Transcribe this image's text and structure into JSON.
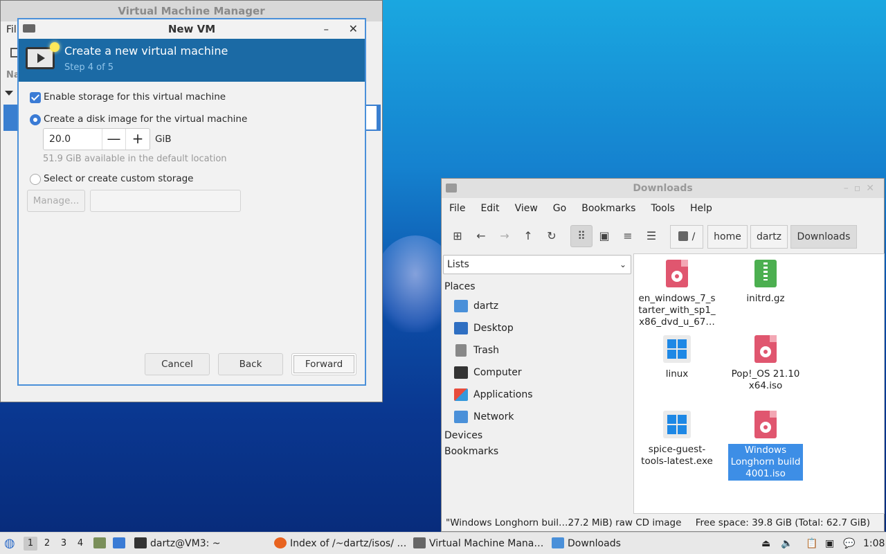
{
  "vmm_window": {
    "title": "Virtual Machine Manager",
    "menu_partial": "Fil",
    "column_partial": "Na"
  },
  "dialog": {
    "title": "New VM",
    "minimize": "–",
    "close": "✕",
    "banner_title": "Create a new virtual machine",
    "banner_step": "Step 4 of 5",
    "enable_storage": "Enable storage for this virtual machine",
    "create_disk": "Create a disk image for the virtual machine",
    "disk_size": "20.0",
    "minus": "—",
    "plus": "+",
    "unit": "GiB",
    "available": "51.9 GiB available in the default location",
    "custom_storage": "Select or create custom storage",
    "manage_label": "Manage...",
    "cancel_label": "Cancel",
    "back_label": "Back",
    "forward_label": "Forward"
  },
  "file_manager": {
    "title": "Downloads",
    "menu": [
      "File",
      "Edit",
      "View",
      "Go",
      "Bookmarks",
      "Tools",
      "Help"
    ],
    "breadcrumbs": [
      "/",
      "home",
      "dartz",
      "Downloads"
    ],
    "side_pane_mode": "Lists",
    "places_header": "Places",
    "places": [
      "dartz",
      "Desktop",
      "Trash",
      "Computer",
      "Applications",
      "Network"
    ],
    "devices_header": "Devices",
    "bookmarks_header": "Bookmarks",
    "files": [
      {
        "name_line1": "en_windows_7_s",
        "name_line2": "tarter_with_sp1_",
        "name_line3": "x86_dvd_u_67…",
        "icon": "disc-image-icon"
      },
      {
        "name_line1": "initrd.gz",
        "icon": "archive-icon"
      },
      {
        "name_line1": "linux",
        "icon": "windows-executable-icon"
      },
      {
        "name_line1": "Pop!_OS 21.10",
        "name_line2": "x64.iso",
        "icon": "disc-image-icon"
      },
      {
        "name_line1": "spice-guest-",
        "name_line2": "tools-latest.exe",
        "icon": "windows-executable-icon"
      },
      {
        "name_line1": "Windows",
        "name_line2": "Longhorn build",
        "name_line3": "4001.iso",
        "icon": "disc-image-icon"
      }
    ],
    "status_selection": "\"Windows Longhorn buil…27.2 MiB) raw CD image",
    "status_free": "Free space: 39.8 GiB (Total: 62.7 GiB)"
  },
  "taskbar": {
    "workspaces": [
      "1",
      "2",
      "3",
      "4"
    ],
    "terminal": "dartz@VM3: ~",
    "firefox": "Index of /~dartz/isos/ …",
    "vmm": "Virtual Machine Mana…",
    "downloads": "Downloads",
    "clock": "1:08"
  },
  "colors": {
    "accent": "#1b6aa5",
    "selection": "#3d8ee6"
  }
}
